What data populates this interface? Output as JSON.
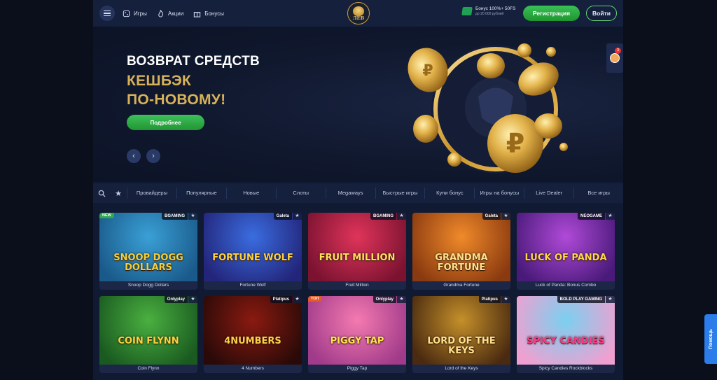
{
  "header": {
    "nav": [
      {
        "label": "Игры",
        "icon": "dice-icon"
      },
      {
        "label": "Акции",
        "icon": "fire-icon"
      },
      {
        "label": "Бонусы",
        "icon": "gift-icon"
      }
    ],
    "logo_text": "ЛЕВ",
    "bonus_line1": "Бонус 100%+ 50FS",
    "bonus_line2": "до 20 000 рублей",
    "register_label": "Регистрация",
    "login_label": "Войти"
  },
  "banner": {
    "title": "ВОЗВРАТ СРЕДСТВ",
    "subtitle_line1": "КЕШБЭК",
    "subtitle_line2": "ПО-НОВОМУ!",
    "more_label": "Подробнее",
    "prev_icon": "chevron-left-icon",
    "next_icon": "chevron-right-icon",
    "coin_symbol": "₽"
  },
  "tabs": [
    "Провайдеры",
    "Популярные",
    "Новые",
    "Слоты",
    "Megaways",
    "Быстрые игры",
    "Купи бонус",
    "Игры на бонусы",
    "Live Dealer",
    "Все игры"
  ],
  "games": [
    {
      "name": "Snoop Dogg Dollars",
      "provider": "BGAMING",
      "badge": "NEW",
      "badge_color": "#2fa84f",
      "art": "SNOOP DOGG DOLLARS",
      "colors": [
        "#3aa0d6",
        "#1a5a8a"
      ],
      "text_color": "#f3cf3a"
    },
    {
      "name": "Fortune Wolf",
      "provider": "Galeta",
      "badge": "",
      "badge_color": "",
      "art": "FORTUNE WOLF",
      "colors": [
        "#3a6de0",
        "#23257a"
      ],
      "text_color": "#ffd23a"
    },
    {
      "name": "Fruit Million",
      "provider": "BGAMING",
      "badge": "",
      "badge_color": "",
      "art": "FRUIT MILLION",
      "colors": [
        "#e0345a",
        "#7a1230"
      ],
      "text_color": "#ffe15a"
    },
    {
      "name": "Grandma Fortune",
      "provider": "Galeta",
      "badge": "",
      "badge_color": "",
      "art": "GRANDMA FORTUNE",
      "colors": [
        "#f08a2a",
        "#8a3a10"
      ],
      "text_color": "#ffe08a"
    },
    {
      "name": "Luck of Panda: Bonus Combo",
      "provider": "NEOGAME",
      "badge": "",
      "badge_color": "",
      "art": "LUCK OF PANDA",
      "colors": [
        "#b04ad8",
        "#4a1a7a"
      ],
      "text_color": "#ffd54a"
    },
    {
      "name": "Coin Flynn",
      "provider": "Onlyplay",
      "badge": "",
      "badge_color": "",
      "art": "COIN FLYNN",
      "colors": [
        "#4ab040",
        "#1a5a20"
      ],
      "text_color": "#ffd23a"
    },
    {
      "name": "4 Numbers",
      "provider": "Platipus",
      "badge": "",
      "badge_color": "",
      "art": "4NUMBERS",
      "colors": [
        "#8a1a10",
        "#2a0a08"
      ],
      "text_color": "#ffcf4a"
    },
    {
      "name": "Piggy Tap",
      "provider": "Onlyplay",
      "badge": "ТОП",
      "badge_color": "#e35a2a",
      "art": "PIGGY TAP",
      "colors": [
        "#f47ab0",
        "#a03a8a"
      ],
      "text_color": "#ffe44a"
    },
    {
      "name": "Lord of the Keys",
      "provider": "Platipus",
      "badge": "",
      "badge_color": "",
      "art": "LORD OF THE KEYS",
      "colors": [
        "#c5902a",
        "#4a2a10"
      ],
      "text_color": "#ffe08a"
    },
    {
      "name": "Spicy Candies Rockblocks",
      "provider": "BOLD PLAY GAMING",
      "badge": "",
      "badge_color": "",
      "art": "SPICY CANDIES",
      "colors": [
        "#7ad0f0",
        "#f0a0d0"
      ],
      "text_color": "#ff3a8a"
    }
  ],
  "side": {
    "chat_count": "3",
    "help_label": "Помощь"
  },
  "colors": {
    "accent_green": "#28a83c",
    "header_bg": "#15203d",
    "gold": "#d8b25a"
  }
}
